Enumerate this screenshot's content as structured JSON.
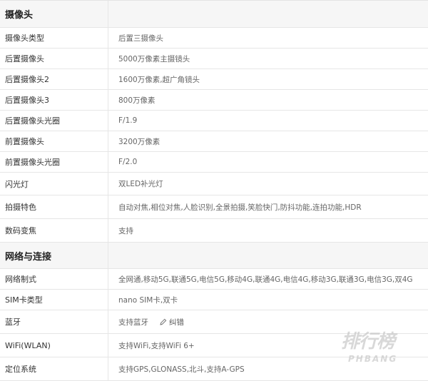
{
  "sections": [
    {
      "title": "摄像头",
      "rows": [
        {
          "key": "摄像头类型",
          "value": "后置三摄像头"
        },
        {
          "key": "后置摄像头",
          "value": "5000万像素主摄镜头"
        },
        {
          "key": "后置摄像头2",
          "value": "1600万像素,超广角镜头"
        },
        {
          "key": "后置摄像头3",
          "value": "800万像素"
        },
        {
          "key": "后置摄像头光圈",
          "value": "F/1.9"
        },
        {
          "key": "前置摄像头",
          "value": "3200万像素"
        },
        {
          "key": "前置摄像头光圈",
          "value": "F/2.0"
        },
        {
          "key": "闪光灯",
          "value": "双LED补光灯"
        },
        {
          "key": "拍摄特色",
          "value": "自动对焦,相位对焦,人脸识别,全景拍摄,笑脸快门,防抖功能,连拍功能,HDR"
        },
        {
          "key": "数码变焦",
          "value": "支持"
        }
      ]
    },
    {
      "title": "网络与连接",
      "rows": [
        {
          "key": "网络制式",
          "value": "全网通,移动5G,联通5G,电信5G,移动4G,联通4G,电信4G,移动3G,联通3G,电信3G,双4G"
        },
        {
          "key": "SIM卡类型",
          "value": "nano SIM卡,双卡"
        },
        {
          "key": "蓝牙",
          "value": "支持蓝牙",
          "link": "纠错"
        },
        {
          "key": "WiFi(WLAN)",
          "value": "支持WiFi,支持WiFi 6+"
        },
        {
          "key": "定位系统",
          "value": "支持GPS,GLONASS,北斗,支持A-GPS"
        }
      ]
    }
  ],
  "watermark": {
    "main": "排行榜",
    "sub": "PHBANG"
  },
  "icons": {
    "fix": "pencil-icon"
  }
}
